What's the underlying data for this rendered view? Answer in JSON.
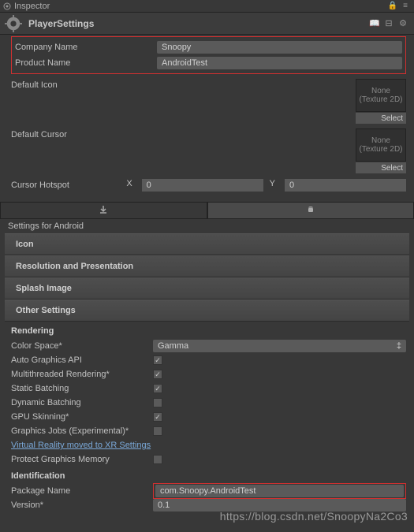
{
  "window": {
    "tab": "Inspector"
  },
  "header": {
    "title": "PlayerSettings"
  },
  "fields": {
    "companyName": {
      "label": "Company Name",
      "value": "Snoopy"
    },
    "productName": {
      "label": "Product Name",
      "value": "AndroidTest"
    },
    "defaultIcon": {
      "label": "Default Icon",
      "thumb": "None\n(Texture 2D)",
      "select": "Select"
    },
    "defaultCursor": {
      "label": "Default Cursor",
      "thumb": "None\n(Texture 2D)",
      "select": "Select"
    },
    "cursorHotspot": {
      "label": "Cursor Hotspot",
      "xLabel": "X",
      "xValue": "0",
      "yLabel": "Y",
      "yValue": "0"
    }
  },
  "settingsFor": "Settings for Android",
  "sections": {
    "icon": "Icon",
    "resolution": "Resolution and Presentation",
    "splash": "Splash Image",
    "other": "Other Settings"
  },
  "rendering": {
    "title": "Rendering",
    "colorSpace": {
      "label": "Color Space*",
      "value": "Gamma"
    },
    "autoGraphics": {
      "label": "Auto Graphics API",
      "checked": true
    },
    "multithreaded": {
      "label": "Multithreaded Rendering*",
      "checked": true
    },
    "staticBatching": {
      "label": "Static Batching",
      "checked": true
    },
    "dynamicBatching": {
      "label": "Dynamic Batching",
      "checked": false
    },
    "gpuSkinning": {
      "label": "GPU Skinning*",
      "checked": true
    },
    "graphicsJobs": {
      "label": "Graphics Jobs (Experimental)*",
      "checked": false
    },
    "vrLink": "Virtual Reality moved to XR Settings",
    "protectMemory": {
      "label": "Protect Graphics Memory",
      "checked": false
    }
  },
  "identification": {
    "title": "Identification",
    "packageName": {
      "label": "Package Name",
      "value": "com.Snoopy.AndroidTest"
    },
    "version": {
      "label": "Version*",
      "value": "0.1"
    }
  },
  "watermark": "https://blog.csdn.net/SnoopyNa2Co3"
}
